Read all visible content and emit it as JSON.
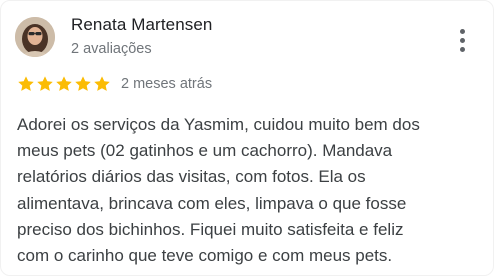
{
  "review": {
    "author_name": "Renata Martensen",
    "author_meta": "2 avaliações",
    "rating": 5,
    "rating_max": 5,
    "star_color": "#fbbc04",
    "date": "2 meses atrás",
    "text": "Adorei os serviços da Yasmim, cuidou muito bem dos\nmeus pets (02 gatinhos e um cachorro). Mandava\nrelatórios diários das visitas, com fotos. Ela os\nalimentava, brincava com eles, limpava o que fosse\npreciso dos bichinhos. Fiquei muito satisfeita e feliz\ncom o carinho que teve comigo e com meus pets.",
    "menu_icon": "more-vert-icon"
  }
}
